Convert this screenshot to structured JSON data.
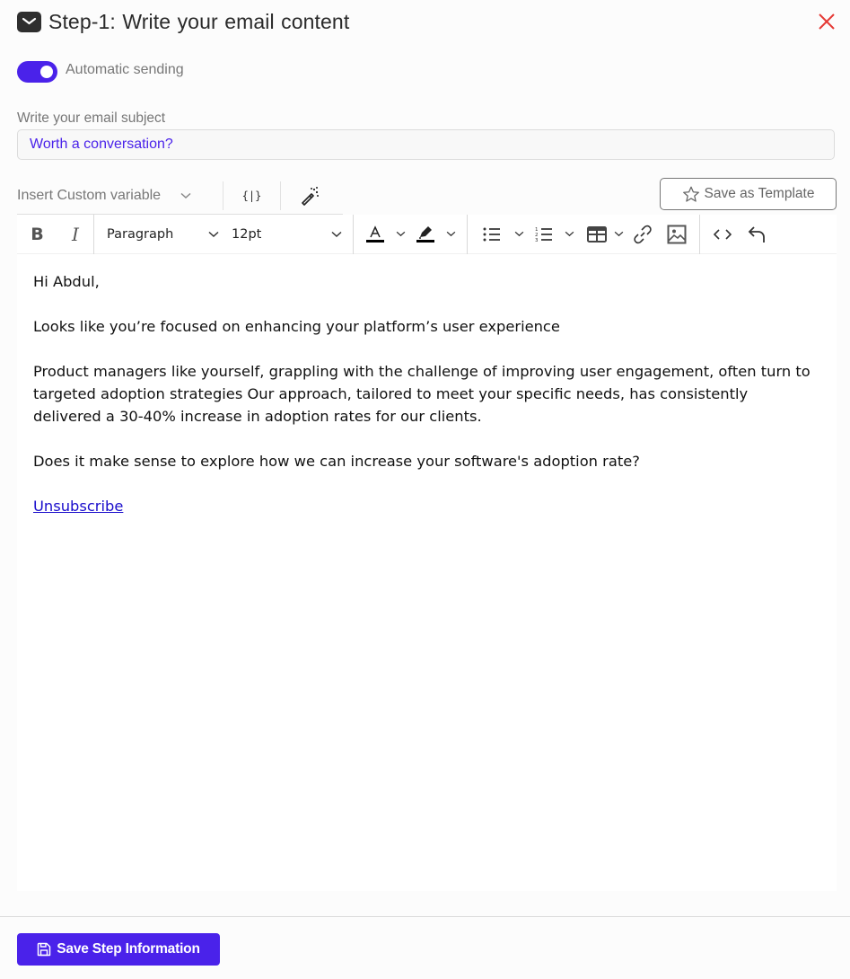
{
  "header": {
    "title": "Step-1:  Write your email content",
    "icon": "envelope-icon",
    "close_icon": "close-icon",
    "close_color": "#e53935"
  },
  "automatic_sending": {
    "label": "Automatic sending",
    "enabled": true,
    "accent": "#4a22ea"
  },
  "subject": {
    "label": "Write your email subject",
    "value": "Worth a conversation?"
  },
  "variables": {
    "select_label": "Insert Custom variable",
    "variable_icon_label": "{|}",
    "magic_icon": "magic-wand-icon"
  },
  "template_button": {
    "label": "Save as Template",
    "icon": "star-icon"
  },
  "toolbar": {
    "bold": "B",
    "italic": "I",
    "block_format": "Paragraph",
    "font_size": "12pt",
    "text_color_icon": "text-color-icon",
    "highlight_icon": "highlight-icon",
    "bullet_list_icon": "bullet-list-icon",
    "numbered_list_icon": "numbered-list-icon",
    "table_icon": "table-icon",
    "link_icon": "link-icon",
    "image_icon": "image-icon",
    "code_icon": "code-icon",
    "undo_icon": "undo-icon"
  },
  "body": {
    "greeting": "Hi Abdul,",
    "paragraphs": [
      "Looks like you’re focused on enhancing your platform’s user experience",
      "Product managers like yourself, grappling with the challenge of improving user engagement, often turn to targeted adoption strategies Our approach, tailored to meet your specific needs, has consistently delivered a 30-40% increase in adoption rates for our clients.",
      "Does it make sense to explore how we can increase your software's adoption rate?"
    ],
    "unsubscribe": "Unsubscribe"
  },
  "footer": {
    "save_label": "Save Step Information",
    "save_icon": "floppy-disk-icon"
  }
}
